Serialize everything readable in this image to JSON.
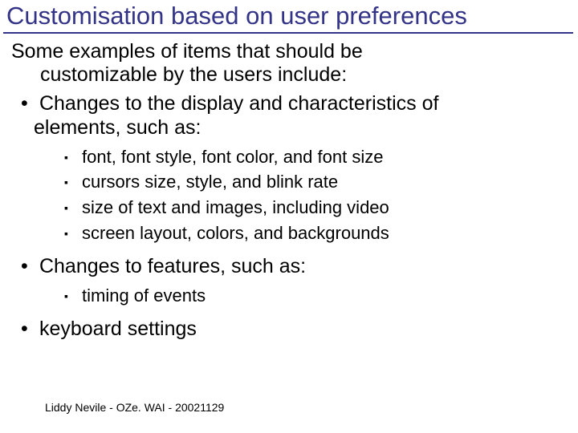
{
  "title": "Customisation based on user preferences",
  "intro": {
    "line1": "Some examples of items that should be",
    "line2": "customizable by the users include:"
  },
  "bullets": {
    "b1": {
      "line1": "Changes to the display and characteristics of",
      "line2": "elements, such as:",
      "sub": [
        "font, font style, font color, and font size",
        "cursors size, style, and blink rate",
        "size of text and images, including video",
        "screen layout, colors, and backgrounds"
      ]
    },
    "b2": {
      "line1": "Changes to features, such as:",
      "sub": [
        "timing of events"
      ]
    },
    "b3": {
      "line1": "keyboard settings"
    }
  },
  "footer": "Liddy Nevile - OZe. WAI - 20021129"
}
